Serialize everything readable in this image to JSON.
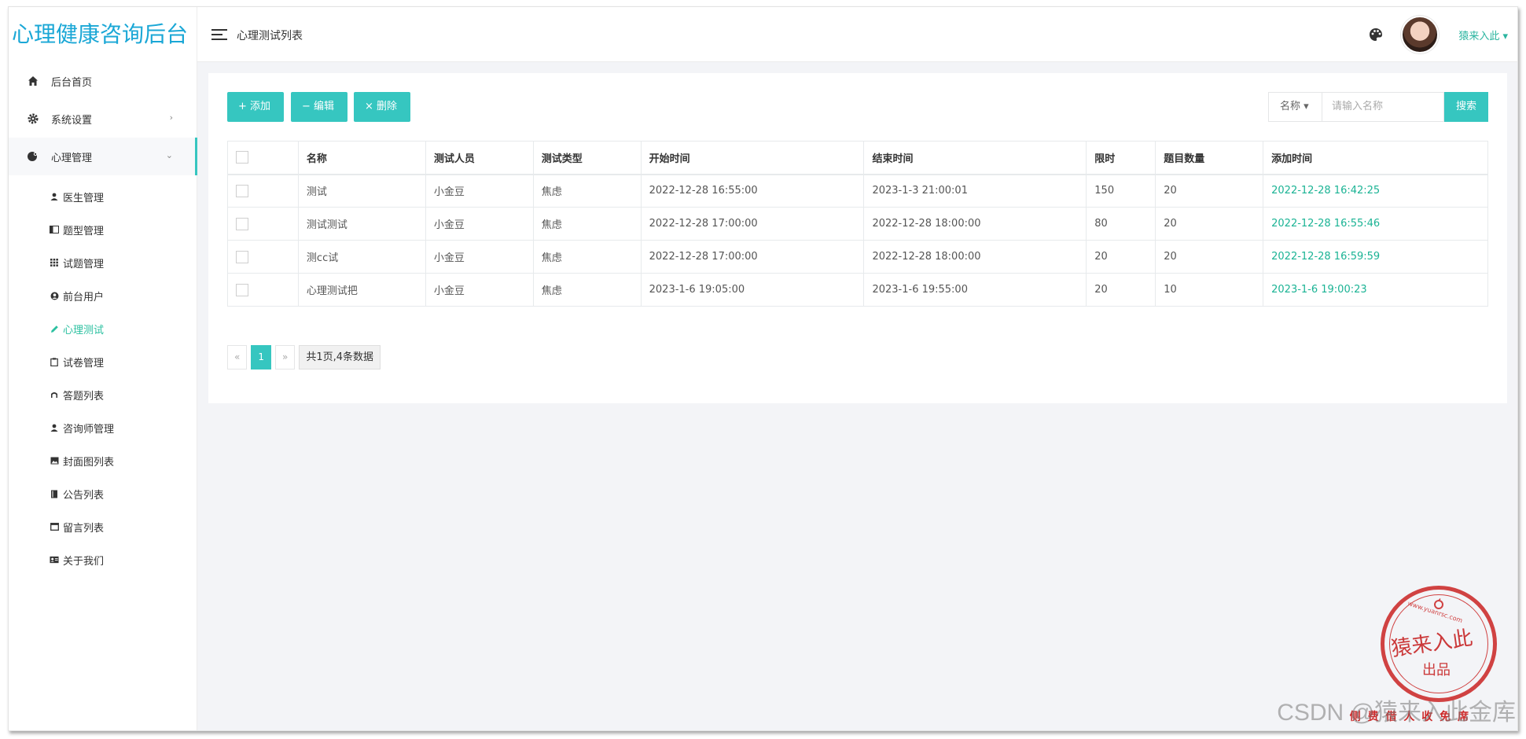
{
  "app": {
    "title": "心理健康咨询后台"
  },
  "sidebar": {
    "items": [
      {
        "label": "后台首页",
        "icon": "home-icon"
      },
      {
        "label": "系统设置",
        "icon": "gear-icon",
        "chevron": "›"
      },
      {
        "label": "心理管理",
        "icon": "brain-icon",
        "chevron": "⌄"
      }
    ],
    "submenu": [
      {
        "label": "医生管理",
        "icon": "user-icon"
      },
      {
        "label": "题型管理",
        "icon": "book-icon"
      },
      {
        "label": "试题管理",
        "icon": "grid-icon"
      },
      {
        "label": "前台用户",
        "icon": "user-circle-icon"
      },
      {
        "label": "心理测试",
        "icon": "pencil-icon",
        "active": true
      },
      {
        "label": "试卷管理",
        "icon": "clipboard-icon"
      },
      {
        "label": "答题列表",
        "icon": "ruler-icon"
      },
      {
        "label": "咨询师管理",
        "icon": "user-icon"
      },
      {
        "label": "封面图列表",
        "icon": "image-icon"
      },
      {
        "label": "公告列表",
        "icon": "notebook-icon"
      },
      {
        "label": "留言列表",
        "icon": "window-icon"
      },
      {
        "label": "关于我们",
        "icon": "id-card-icon"
      }
    ]
  },
  "header": {
    "breadcrumb": "心理测试列表",
    "username": "猿来入此 ▾"
  },
  "toolbar": {
    "add_label": "+ 添加",
    "edit_label": "− 编辑",
    "delete_label": "× 删除"
  },
  "search": {
    "field": "名称 ▾",
    "placeholder": "请输入名称",
    "button": "搜索"
  },
  "table": {
    "headers": [
      "名称",
      "测试人员",
      "测试类型",
      "开始时间",
      "结束时间",
      "限时",
      "题目数量",
      "添加时间"
    ],
    "rows": [
      [
        "测试",
        "小金豆",
        "焦虑",
        "2022-12-28 16:55:00",
        "2023-1-3 21:00:01",
        "150",
        "20",
        "2022-12-28 16:42:25"
      ],
      [
        "测试测试",
        "小金豆",
        "焦虑",
        "2022-12-28 17:00:00",
        "2022-12-28 18:00:00",
        "80",
        "20",
        "2022-12-28 16:55:46"
      ],
      [
        "测cc试",
        "小金豆",
        "焦虑",
        "2022-12-28 17:00:00",
        "2022-12-28 18:00:00",
        "20",
        "20",
        "2022-12-28 16:59:59"
      ],
      [
        "心理测试把",
        "小金豆",
        "焦虑",
        "2023-1-6 19:05:00",
        "2023-1-6 19:55:00",
        "20",
        "10",
        "2023-1-6 19:00:23"
      ]
    ]
  },
  "pager": {
    "prev": "«",
    "current": "1",
    "next": "»",
    "info": "共1页,4条数据"
  },
  "stamp": {
    "url": "www.yuanrsc.com",
    "main": "猿来入此",
    "sub": "出品",
    "bottom": "侧 费 借 人 收 免 席"
  },
  "watermark": "CSDN @猿来入此金库",
  "colors": {
    "brand": "#1aa7d6",
    "accent": "#36c6c0",
    "added_time": "#1ab394",
    "stamp": "#cc2a2a"
  }
}
